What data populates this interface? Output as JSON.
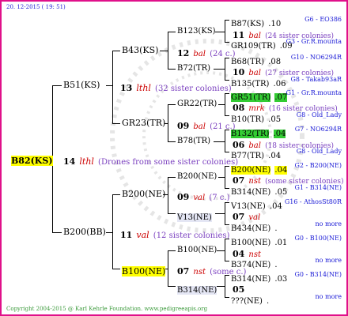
{
  "header": {
    "date": "20. 12-2015 ( 19: 51)"
  },
  "footer": {
    "copyright": "Copyright 2004-2015 @ Karl Kehrle Foundation.",
    "site": "www.pedigreeapis.org"
  },
  "root": {
    "name": "B82(KS)",
    "gen": "14",
    "queen_line": "lthl",
    "sisters": "(Drones from some sister colonies)"
  },
  "gen1": [
    {
      "name": "B51(KS)",
      "gen": "13",
      "queen_line": "lthl",
      "sisters": "(32 sister colonies)"
    },
    {
      "name": "B200(BB)",
      "gen": "11",
      "queen_line": "val",
      "sisters": "(12 sister colonies)"
    }
  ],
  "gen2": [
    {
      "name": "B43(KS)",
      "gen": "12",
      "queen_line": "bal",
      "sisters": "(24 c.)"
    },
    {
      "name": "GR23(TR)",
      "gen": "09",
      "queen_line": "bal",
      "sisters": "(21 c.)"
    },
    {
      "name": "B200(NE)",
      "gen": "09",
      "queen_line": "val",
      "sisters": "(7 c.)"
    },
    {
      "name": "B100(NE)",
      "gen": "07",
      "queen_line": "nst",
      "sisters": "(some c.)"
    }
  ],
  "gen3": [
    {
      "name": "B123(KS)",
      "gen": "11",
      "queen_line": "bal",
      "sisters": "(24 sister colonies)"
    },
    {
      "name": "B72(TR)",
      "gen": "10",
      "queen_line": "bal",
      "sisters": "(27 sister colonies)"
    },
    {
      "name": "GR22(TR)",
      "gen": "08",
      "queen_line": "mrk",
      "sisters": "(16 sister colonies)"
    },
    {
      "name": "B78(TR)",
      "gen": "06",
      "queen_line": "bal",
      "sisters": "(18 sister colonies)"
    },
    {
      "name": "B200(NE)",
      "gen": "07",
      "queen_line": "nst",
      "sisters": "(some sister colonies)"
    },
    {
      "name": "V13(NE)",
      "gen": "07",
      "queen_line": "val",
      "sisters": ""
    },
    {
      "name": "B100(NE)",
      "gen": "04",
      "queen_line": "nst",
      "sisters": ""
    },
    {
      "name": "B314(NE)",
      "gen": "05",
      "queen_line": "",
      "sisters": ""
    }
  ],
  "gen4": [
    {
      "name": "B87(KS)",
      "gen": ".10",
      "ctr": "G6 - EO386"
    },
    {
      "name": "GR109(TR)",
      "gen": ".09",
      "ctr": "G3 - Gr.R.mounta"
    },
    {
      "name": "B68(TR)",
      "gen": ".08",
      "ctr": "G10 - NO6294R"
    },
    {
      "name": "B135(TR)",
      "gen": ".06",
      "ctr": "G8 - Takab93aR"
    },
    {
      "name": "GR51(TR)",
      "gen": ".07",
      "ctr": "G1 - Gr.R.mounta"
    },
    {
      "name": "B10(TR)",
      "gen": ".05",
      "ctr": "G8 - Old_Lady"
    },
    {
      "name": "B132(TR)",
      "gen": ".04",
      "ctr": "G7 - NO6294R"
    },
    {
      "name": "B77(TR)",
      "gen": ".04",
      "ctr": "G8 - Old_Lady"
    },
    {
      "name": "B200(NE)",
      "gen": ".04",
      "ctr": "G2 - B200(NE)"
    },
    {
      "name": "B314(NE)",
      "gen": ".05",
      "ctr": "G1 - B314(NE)"
    },
    {
      "name": "V13(NE)",
      "gen": ".04",
      "ctr": "G16 - AthosSt80R"
    },
    {
      "name": "B434(NE)",
      "gen": ".",
      "ctr": "no more"
    },
    {
      "name": "B100(NE)",
      "gen": ".01",
      "ctr": "G0 - B100(NE)"
    },
    {
      "name": "B374(NE)",
      "gen": ".",
      "ctr": "no more"
    },
    {
      "name": "B314(NE)",
      "gen": ".03",
      "ctr": "G0 - B314(NE)"
    },
    {
      "name": "???(NE)",
      "gen": ".",
      "ctr": "no more"
    }
  ]
}
